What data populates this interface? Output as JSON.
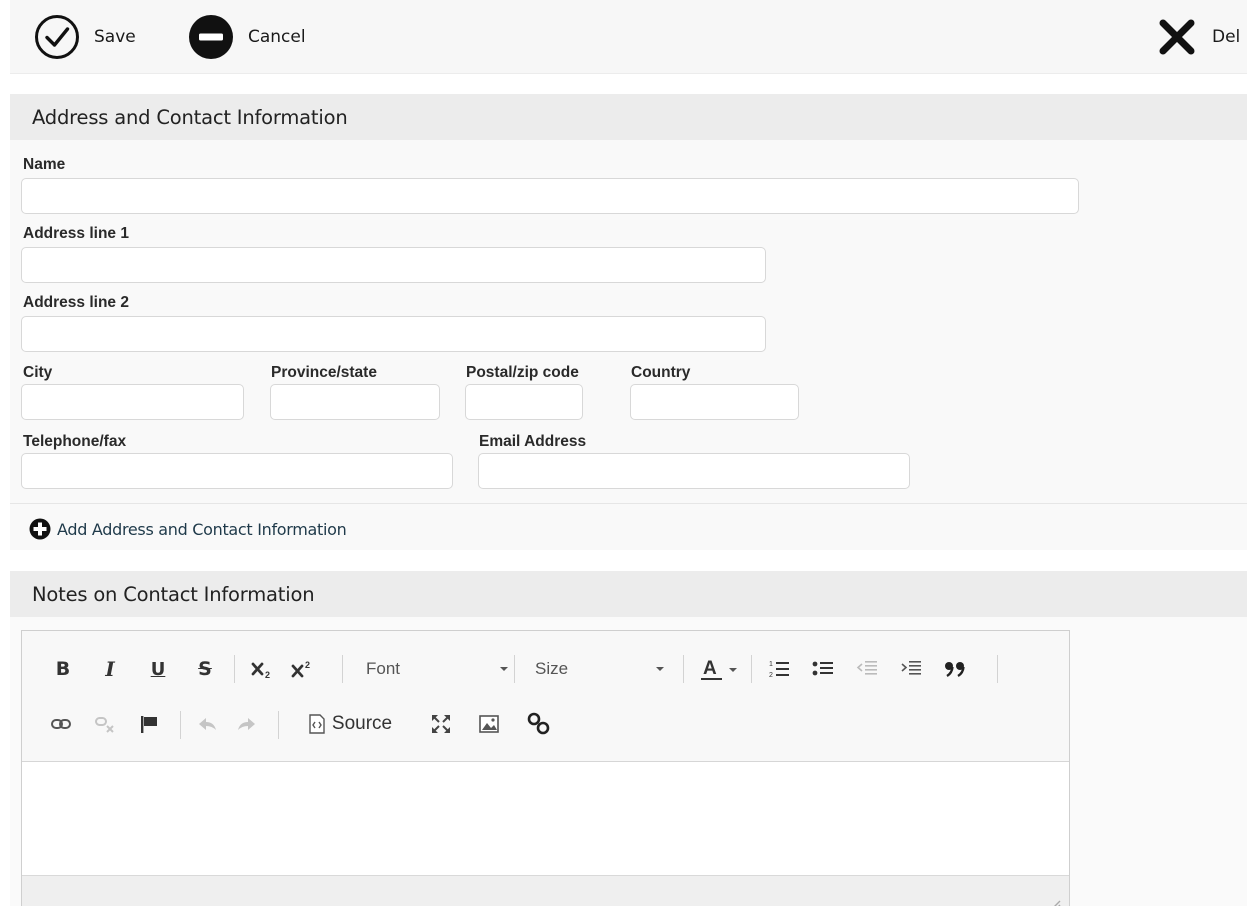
{
  "toolbar": {
    "save_label": "Save",
    "cancel_label": "Cancel",
    "delete_label": "Del"
  },
  "address_panel": {
    "title": "Address and Contact Information",
    "fields": {
      "name": {
        "label": "Name",
        "value": ""
      },
      "address1": {
        "label": "Address line 1",
        "value": ""
      },
      "address2": {
        "label": "Address line 2",
        "value": ""
      },
      "city": {
        "label": "City",
        "value": ""
      },
      "province": {
        "label": "Province/state",
        "value": ""
      },
      "postal": {
        "label": "Postal/zip code",
        "value": ""
      },
      "country": {
        "label": "Country",
        "value": ""
      },
      "telephone": {
        "label": "Telephone/fax",
        "value": ""
      },
      "email": {
        "label": "Email Address",
        "value": ""
      }
    },
    "add_link": "Add Address and Contact Information"
  },
  "notes_panel": {
    "title": "Notes on Contact Information",
    "editor": {
      "font_combo": "Font",
      "size_combo": "Size",
      "source_label": "Source",
      "buttons_row1": [
        "bold",
        "italic",
        "underline",
        "strikethrough",
        "subscript",
        "superscript",
        "text-color",
        "numbered-list",
        "bulleted-list",
        "decrease-indent",
        "increase-indent",
        "blockquote"
      ],
      "buttons_row2": [
        "link",
        "unlink",
        "anchor",
        "undo",
        "redo",
        "source",
        "maximize",
        "image",
        "link-chain"
      ]
    }
  }
}
